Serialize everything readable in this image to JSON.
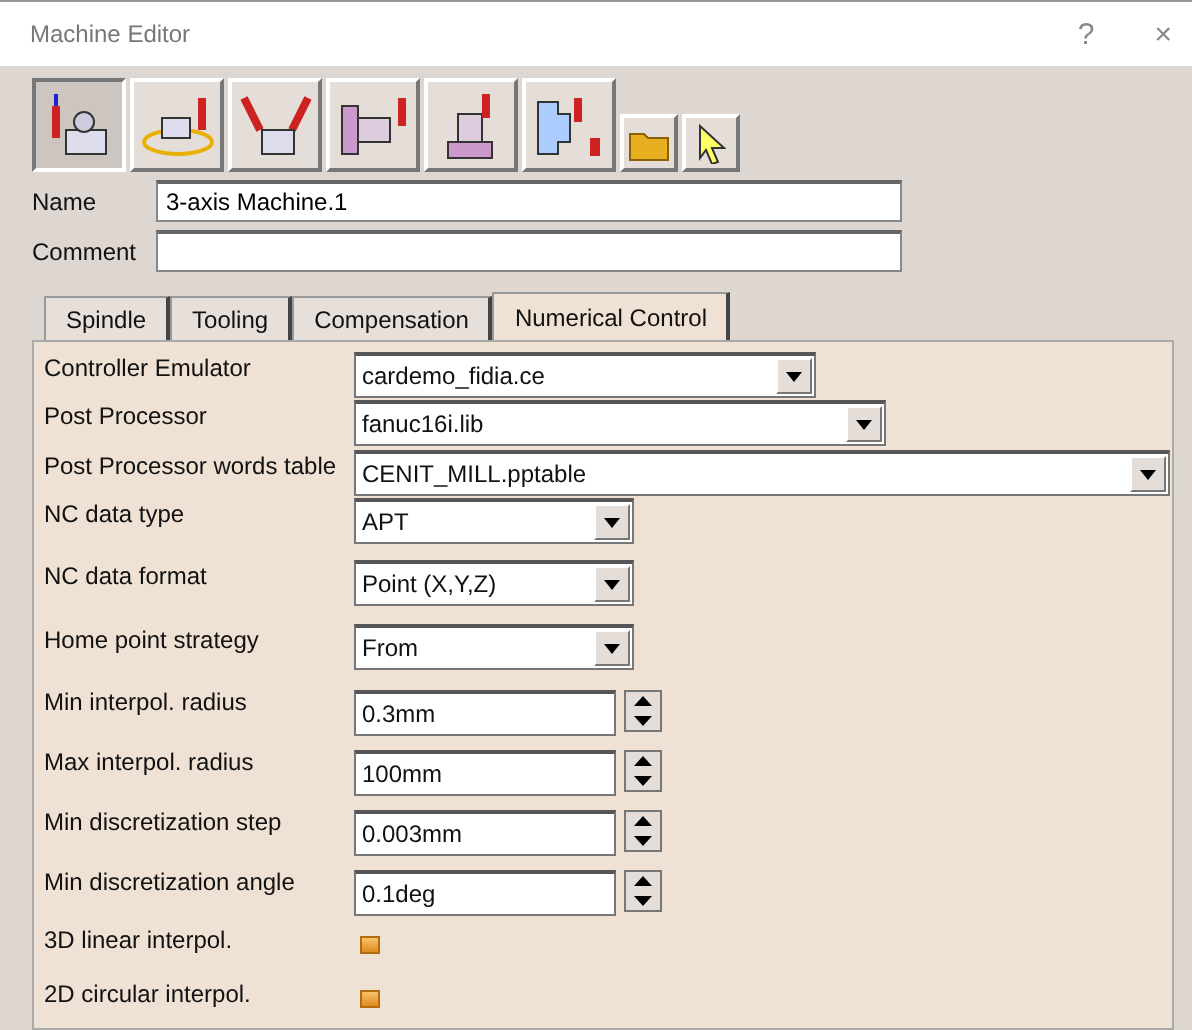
{
  "window": {
    "title": "Machine Editor",
    "help": "?",
    "close": "×"
  },
  "toolbar": [
    {
      "selected": true
    },
    {
      "selected": false
    },
    {
      "selected": false
    },
    {
      "selected": false
    },
    {
      "selected": false
    },
    {
      "selected": false
    },
    {
      "selected": false
    },
    {
      "selected": false
    }
  ],
  "name": {
    "label": "Name",
    "value": "3-axis Machine.1"
  },
  "comment": {
    "label": "Comment"
  },
  "tabs": [
    {
      "label": "Spindle",
      "selected": false
    },
    {
      "label": "Tooling",
      "selected": false
    },
    {
      "label": "Compensation",
      "selected": false
    },
    {
      "label": "Numerical Control",
      "selected": true
    }
  ],
  "rows": [
    {
      "kind": "combo",
      "label": "Controller Emulator",
      "value": "cardemo_fidia.ce"
    },
    {
      "kind": "combo",
      "label": "Post Processor",
      "value": "fanuc16i.lib"
    },
    {
      "kind": "combo",
      "label": "Post Processor words table",
      "value": "CENIT_MILL.pptable"
    },
    {
      "kind": "combo",
      "label": "NC data type",
      "value": "APT"
    },
    {
      "kind": "combo",
      "label": "NC data format",
      "value": "Point (X,Y,Z)"
    },
    {
      "kind": "combo",
      "label": "Home point strategy",
      "value": "From"
    },
    {
      "kind": "spin",
      "label": "Min interpol. radius",
      "value": "0.3mm"
    },
    {
      "kind": "spin",
      "label": "Max interpol. radius",
      "value": "100mm"
    },
    {
      "kind": "spin",
      "label": "Min discretization step",
      "value": "0.003mm"
    },
    {
      "kind": "spin",
      "label": "Min discretization angle",
      "value": "0.1deg"
    },
    {
      "kind": "check",
      "label": "3D linear interpol.",
      "checked": false
    },
    {
      "kind": "check",
      "label": "2D circular interpol.",
      "checked": false
    }
  ]
}
